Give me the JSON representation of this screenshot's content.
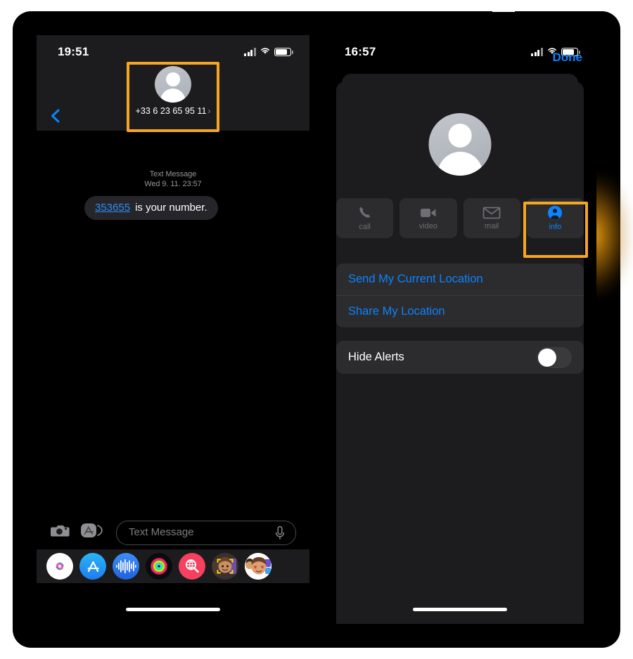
{
  "left_phone": {
    "status_bar": {
      "time": "19:51",
      "signal_icon": "cellular-bars-icon",
      "wifi_icon": "wifi-icon",
      "battery_icon": "battery-icon"
    },
    "nav": {
      "back_icon": "chevron-left-icon",
      "avatar_icon": "contact-avatar-placeholder-icon",
      "contact_number": "+33 6 23 65 95 11",
      "disclosure_icon": "chevron-right-icon"
    },
    "conversation": {
      "service_label": "Text Message",
      "timestamp": "Wed 9. 11. 23:57",
      "messages": [
        {
          "code": "353655",
          "text": "is your number."
        }
      ]
    },
    "input_bar": {
      "camera_icon": "camera-icon",
      "apps_icon": "app-store-icon",
      "placeholder": "Text Message",
      "value": "",
      "mic_icon": "microphone-icon"
    },
    "app_drawer": [
      {
        "name": "photos-app-icon",
        "label": "Photos"
      },
      {
        "name": "app-store-app-icon",
        "label": "App Store"
      },
      {
        "name": "music-app-icon",
        "label": "Music"
      },
      {
        "name": "fitness-app-icon",
        "label": "Fitness"
      },
      {
        "name": "image-search-app-icon",
        "label": "#images"
      },
      {
        "name": "memoji-app-icon",
        "label": "Memoji"
      },
      {
        "name": "memoji-stickers-app-icon",
        "label": "Memoji Stickers"
      }
    ],
    "home_indicator": "home-indicator"
  },
  "right_phone": {
    "status_bar": {
      "time": "16:57",
      "signal_icon": "cellular-bars-icon",
      "wifi_icon": "wifi-icon",
      "battery_icon": "battery-icon"
    },
    "sheet": {
      "done_label": "Done",
      "avatar_icon": "contact-avatar-placeholder-icon",
      "actions": [
        {
          "icon": "phone-icon",
          "label": "call",
          "active": false
        },
        {
          "icon": "video-camera-icon",
          "label": "video",
          "active": false
        },
        {
          "icon": "envelope-icon",
          "label": "mail",
          "active": false
        },
        {
          "icon": "person-circle-icon",
          "label": "info",
          "active": true
        }
      ],
      "location_rows": [
        "Send My Current Location",
        "Share My Location"
      ],
      "alerts_row": {
        "label": "Hide Alerts",
        "toggle_state": "off"
      }
    },
    "home_indicator": "home-indicator"
  },
  "annotations": {
    "highlight_color": "#f5a623",
    "boxes": [
      {
        "name": "contact-header-highlight",
        "target": "contact header in conversation"
      },
      {
        "name": "info-button-highlight",
        "target": "info action button"
      }
    ]
  }
}
